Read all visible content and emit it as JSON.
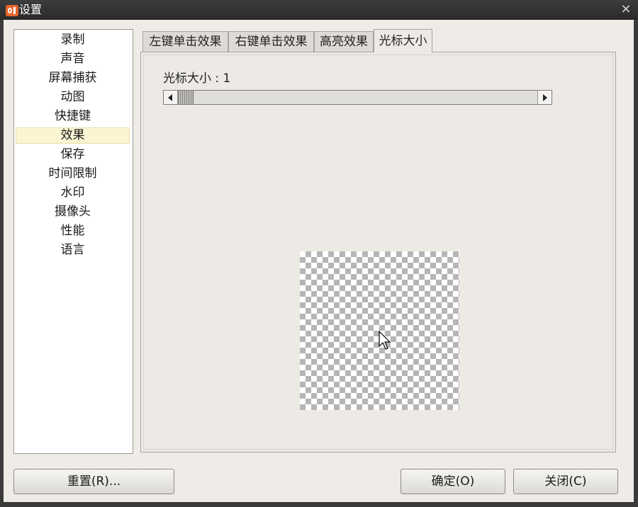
{
  "window": {
    "title": "设置",
    "icons": {
      "app": "app-logo-icon",
      "close": "close-icon"
    },
    "close_glyph": "×"
  },
  "sidebar": {
    "items": [
      {
        "label": "录制"
      },
      {
        "label": "声音"
      },
      {
        "label": "屏幕捕获"
      },
      {
        "label": "动图"
      },
      {
        "label": "快捷键"
      },
      {
        "label": "效果",
        "selected": true
      },
      {
        "label": "保存"
      },
      {
        "label": "时间限制"
      },
      {
        "label": "水印"
      },
      {
        "label": "摄像头"
      },
      {
        "label": "性能"
      },
      {
        "label": "语言"
      }
    ]
  },
  "tabs": [
    {
      "label": "左键单击效果"
    },
    {
      "label": "右键单击效果"
    },
    {
      "label": "高亮效果"
    },
    {
      "label": "光标大小",
      "active": true
    }
  ],
  "cursor_size": {
    "label": "光标大小 : 1",
    "value": 1
  },
  "preview": {
    "icon": "cursor-arrow-icon"
  },
  "buttons": {
    "reset": "重置(R)...",
    "ok": "确定(O)",
    "close": "关闭(C)"
  },
  "colors": {
    "selected_item_bg": "#fbf5d4",
    "titlebar_bg": "#2f2f2f",
    "dialog_bg": "#efece7"
  }
}
